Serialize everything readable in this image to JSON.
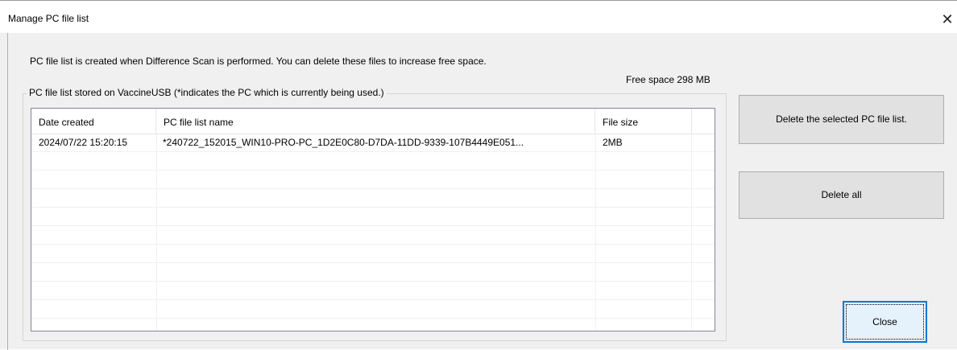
{
  "window": {
    "title": "Manage PC file list",
    "close_glyph": "✕"
  },
  "info_text": "PC file list is created when Difference Scan is performed. You can delete these files to increase free space.",
  "free_space": "Free space 298 MB",
  "group": {
    "label": "PC file list stored on VaccineUSB  (*indicates the PC which is currently being used.)"
  },
  "list": {
    "columns": [
      "Date created",
      "PC file list name",
      "File size"
    ],
    "rows": [
      {
        "date": "2024/07/22 15:20:15",
        "name": "*240722_152015_WIN10-PRO-PC_1D2E0C80-D7DA-11DD-9339-107B4449E051...",
        "size": "2MB"
      }
    ]
  },
  "buttons": {
    "delete_selected": "Delete the selected PC file list.",
    "delete_all": "Delete all",
    "close": "Close"
  },
  "colors": {
    "focus_border": "#0078d7",
    "button_bg": "#e1e1e1",
    "dialog_bg": "#f0f0f0"
  }
}
